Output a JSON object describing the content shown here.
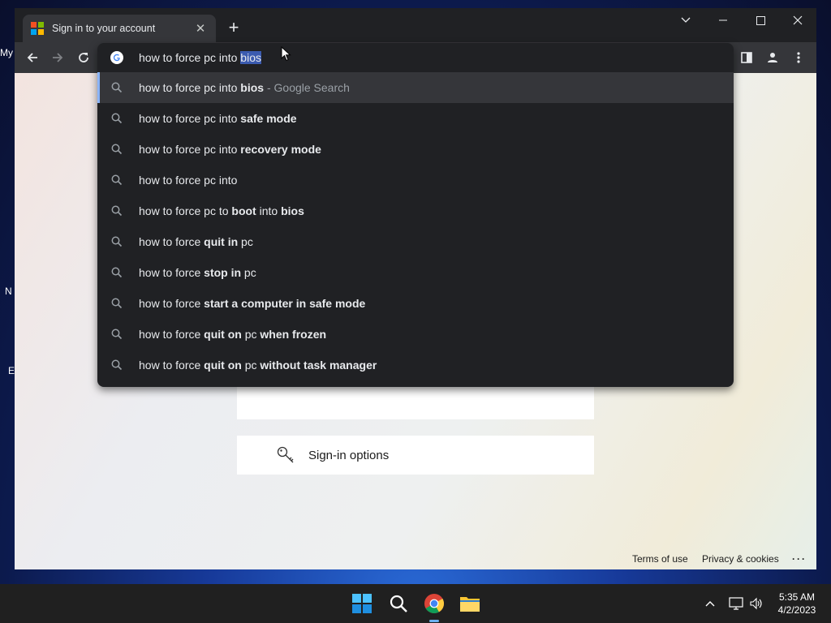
{
  "browser": {
    "tab_title": "Sign in to your account",
    "new_tab_label": "+",
    "tab_close_label": "✕"
  },
  "omnibox": {
    "typed_text": "how to force pc into ",
    "selected_completion": "bios",
    "suggestions": [
      {
        "parts": [
          {
            "t": "how to force pc into ",
            "b": false
          },
          {
            "t": "bios",
            "b": true
          }
        ],
        "hint": " - Google Search"
      },
      {
        "parts": [
          {
            "t": "how to force pc into ",
            "b": false
          },
          {
            "t": "safe mode",
            "b": true
          }
        ]
      },
      {
        "parts": [
          {
            "t": "how to force pc into ",
            "b": false
          },
          {
            "t": "recovery mode",
            "b": true
          }
        ]
      },
      {
        "parts": [
          {
            "t": "how to force pc into",
            "b": false
          }
        ]
      },
      {
        "parts": [
          {
            "t": "how to force pc to ",
            "b": false
          },
          {
            "t": "boot",
            "b": true
          },
          {
            "t": " into ",
            "b": false
          },
          {
            "t": "bios",
            "b": true
          }
        ]
      },
      {
        "parts": [
          {
            "t": "how to force ",
            "b": false
          },
          {
            "t": "quit in",
            "b": true
          },
          {
            "t": " pc",
            "b": false
          }
        ]
      },
      {
        "parts": [
          {
            "t": "how to force ",
            "b": false
          },
          {
            "t": "stop in",
            "b": true
          },
          {
            "t": " pc",
            "b": false
          }
        ]
      },
      {
        "parts": [
          {
            "t": "how to force ",
            "b": false
          },
          {
            "t": "start a computer in safe mode",
            "b": true
          }
        ]
      },
      {
        "parts": [
          {
            "t": "how to force ",
            "b": false
          },
          {
            "t": "quit on",
            "b": true
          },
          {
            "t": " pc ",
            "b": false
          },
          {
            "t": "when frozen",
            "b": true
          }
        ]
      },
      {
        "parts": [
          {
            "t": "how to force ",
            "b": false
          },
          {
            "t": "quit on",
            "b": true
          },
          {
            "t": " pc ",
            "b": false
          },
          {
            "t": "without task manager",
            "b": true
          }
        ]
      }
    ]
  },
  "page": {
    "signin_options_label": "Sign-in options",
    "footer_terms": "Terms of use",
    "footer_privacy": "Privacy & cookies",
    "footer_more": "···"
  },
  "desktop": {
    "icon_labels": [
      "My",
      "N",
      "E"
    ]
  },
  "taskbar": {
    "time": "5:35 AM",
    "date": "4/2/2023"
  },
  "colors": {
    "accent_selection": "#3b5bb0",
    "chrome_dark": "#202124",
    "toolbar": "#35363a"
  }
}
